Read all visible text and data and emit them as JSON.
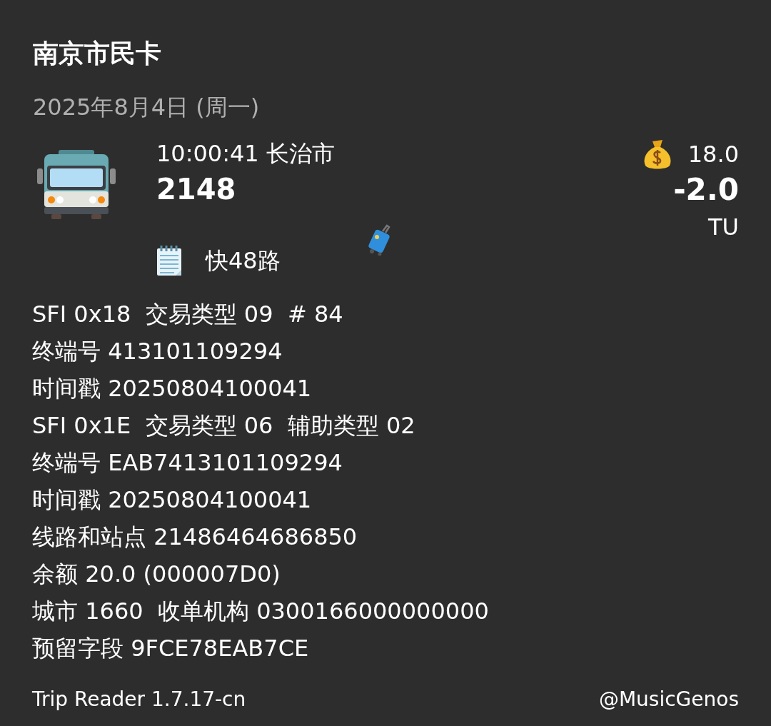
{
  "card_name": "南京市民卡",
  "date": "2025年8月4日 (周一)",
  "trip": {
    "time_place": "10:00:41  长治市",
    "route_number": "2148",
    "balance": "18.0",
    "amount": "-2.0",
    "mode_code": "TU",
    "line_name": "快48路"
  },
  "details": [
    "SFI 0x18  交易类型 09  # 84",
    "终端号 413101109294",
    "时间戳 20250804100041",
    "SFI 0x1E  交易类型 06  辅助类型 02",
    "终端号 EAB7413101109294",
    "时间戳 20250804100041",
    "线路和站点 21486464686850",
    "余额 20.0 (000007D0)",
    "城市 1660  收单机构 0300166000000000",
    "预留字段 9FCE78EAB7CE"
  ],
  "footer": {
    "version": "Trip Reader 1.7.17-cn",
    "credit": "@MusicGenos"
  }
}
